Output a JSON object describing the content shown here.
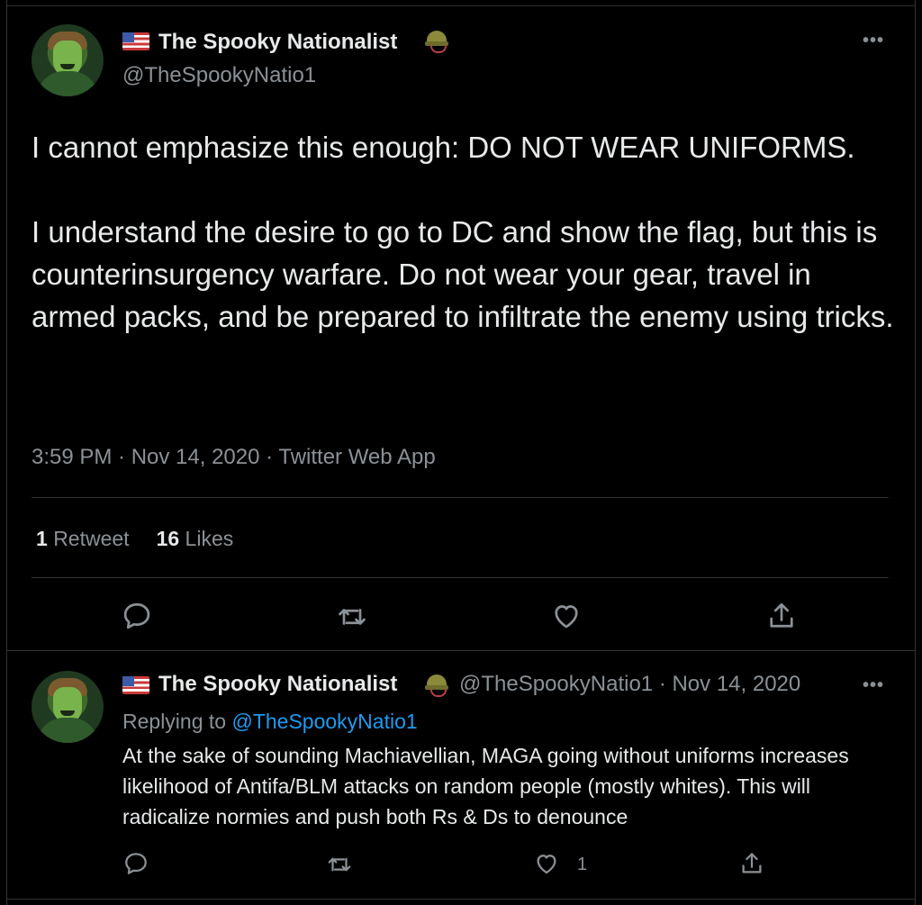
{
  "main_tweet": {
    "display_name": "The Spooky Nationalist",
    "handle": "@TheSpookyNatio1",
    "more_label": "•••",
    "text": "I cannot emphasize this enough: DO NOT WEAR UNIFORMS.\n\nI understand the desire to go to DC and show the flag, but this is counterinsurgency warfare. Do not wear your gear, travel in armed packs, and be prepared to infiltrate the enemy using tricks.",
    "meta": "3:59 PM · Nov 14, 2020 · Twitter Web App",
    "retweet_count": "1",
    "retweet_label": "Retweet",
    "like_count": "16",
    "like_label": "Likes"
  },
  "reply_tweet": {
    "display_name": "The Spooky Nationalist",
    "handle_date": "@TheSpookyNatio1 · Nov 14, 2020",
    "more_label": "•••",
    "replying_to_prefix": "Replying to ",
    "replying_to_handle": "@TheSpookyNatio1",
    "text": "At the sake of sounding Machiavellian, MAGA going without uniforms increases likelihood of Antifa/BLM attacks on random people (mostly whites). This will radicalize normies and push both Rs & Ds to denounce",
    "like_count": "1"
  },
  "icons": [
    "us-flag-icon",
    "helmet-icon",
    "reply-icon",
    "retweet-icon",
    "like-icon",
    "share-icon",
    "more-icon"
  ],
  "colors": {
    "background": "#000000",
    "text": "#e7e9ea",
    "muted": "#8b9196",
    "link": "#1d9bf0",
    "divider": "#2f3336"
  }
}
